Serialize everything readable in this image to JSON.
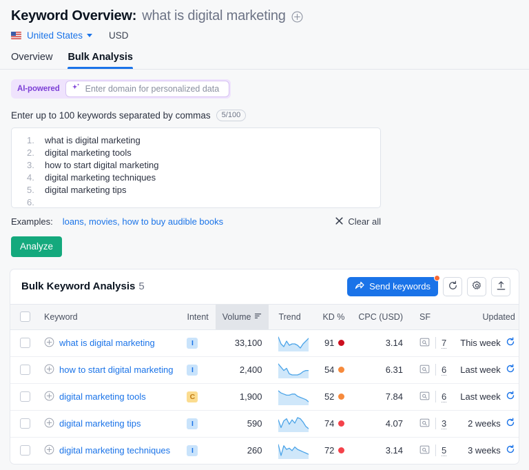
{
  "header": {
    "title_prefix": "Keyword Overview:",
    "keyword": "what is digital marketing",
    "add_icon": "plus-circle-icon",
    "country": "United States",
    "currency": "USD"
  },
  "tabs": [
    {
      "label": "Overview",
      "active": false
    },
    {
      "label": "Bulk Analysis",
      "active": true
    }
  ],
  "ai_domain": {
    "badge": "AI-powered",
    "placeholder": "Enter domain for personalized data",
    "value": "",
    "badge_color": "#7c3fd6"
  },
  "keyword_entry": {
    "label": "Enter up to 100 keywords separated by commas",
    "counter": "5/100",
    "lines": [
      {
        "num": "1.",
        "text": "what is digital marketing"
      },
      {
        "num": "2.",
        "text": "digital marketing tools"
      },
      {
        "num": "3.",
        "text": "how to start digital marketing"
      },
      {
        "num": "4.",
        "text": "digital marketing techniques"
      },
      {
        "num": "5.",
        "text": "digital marketing tips"
      },
      {
        "num": "6.",
        "text": ""
      }
    ],
    "examples_label": "Examples:",
    "examples_links": "loans, movies, how to buy audible books",
    "clear_all": "Clear all",
    "analyze": "Analyze"
  },
  "results": {
    "title": "Bulk Keyword Analysis",
    "count": "5",
    "send_keywords": "Send keywords",
    "icons": [
      "refresh-icon",
      "gear-icon",
      "export-icon"
    ],
    "accent": "#1a73e8",
    "columns": {
      "keyword": "Keyword",
      "intent": "Intent",
      "volume": "Volume",
      "trend": "Trend",
      "kd": "KD %",
      "cpc": "CPC (USD)",
      "sf": "SF",
      "updated": "Updated"
    },
    "sorted_column": "volume",
    "rows": [
      {
        "keyword": "what is digital marketing",
        "intent": "I",
        "intent_type": "informational",
        "volume": "33,100",
        "trend": [
          10,
          5,
          3,
          7,
          4,
          5,
          5,
          4,
          2,
          5,
          7,
          9
        ],
        "kd": "91",
        "kd_color": "#cc0f1f",
        "cpc": "3.14",
        "sf": "7",
        "updated": "This week"
      },
      {
        "keyword": "how to start digital marketing",
        "intent": "I",
        "intent_type": "informational",
        "volume": "2,400",
        "trend": [
          12,
          9,
          6,
          8,
          3,
          2,
          2,
          2,
          3,
          5,
          6,
          6
        ],
        "kd": "54",
        "kd_color": "#f68a3c",
        "cpc": "6.31",
        "sf": "6",
        "updated": "Last week"
      },
      {
        "keyword": "digital marketing tools",
        "intent": "C",
        "intent_type": "commercial",
        "volume": "1,900",
        "trend": [
          11,
          9,
          8,
          7,
          7,
          8,
          8,
          6,
          5,
          4,
          3,
          1
        ],
        "kd": "52",
        "kd_color": "#f68a3c",
        "cpc": "7.84",
        "sf": "6",
        "updated": "Last week"
      },
      {
        "keyword": "digital marketing tips",
        "intent": "I",
        "intent_type": "informational",
        "volume": "590",
        "trend": [
          9,
          2,
          8,
          10,
          5,
          9,
          6,
          11,
          10,
          7,
          3,
          1
        ],
        "kd": "74",
        "kd_color": "#f4424a",
        "cpc": "4.07",
        "sf": "3",
        "updated": "2 weeks"
      },
      {
        "keyword": "digital marketing techniques",
        "intent": "I",
        "intent_type": "informational",
        "volume": "260",
        "trend": [
          10,
          1,
          9,
          6,
          7,
          5,
          8,
          6,
          5,
          4,
          3,
          2
        ],
        "kd": "72",
        "kd_color": "#f4424a",
        "cpc": "3.14",
        "sf": "5",
        "updated": "3 weeks"
      }
    ]
  }
}
